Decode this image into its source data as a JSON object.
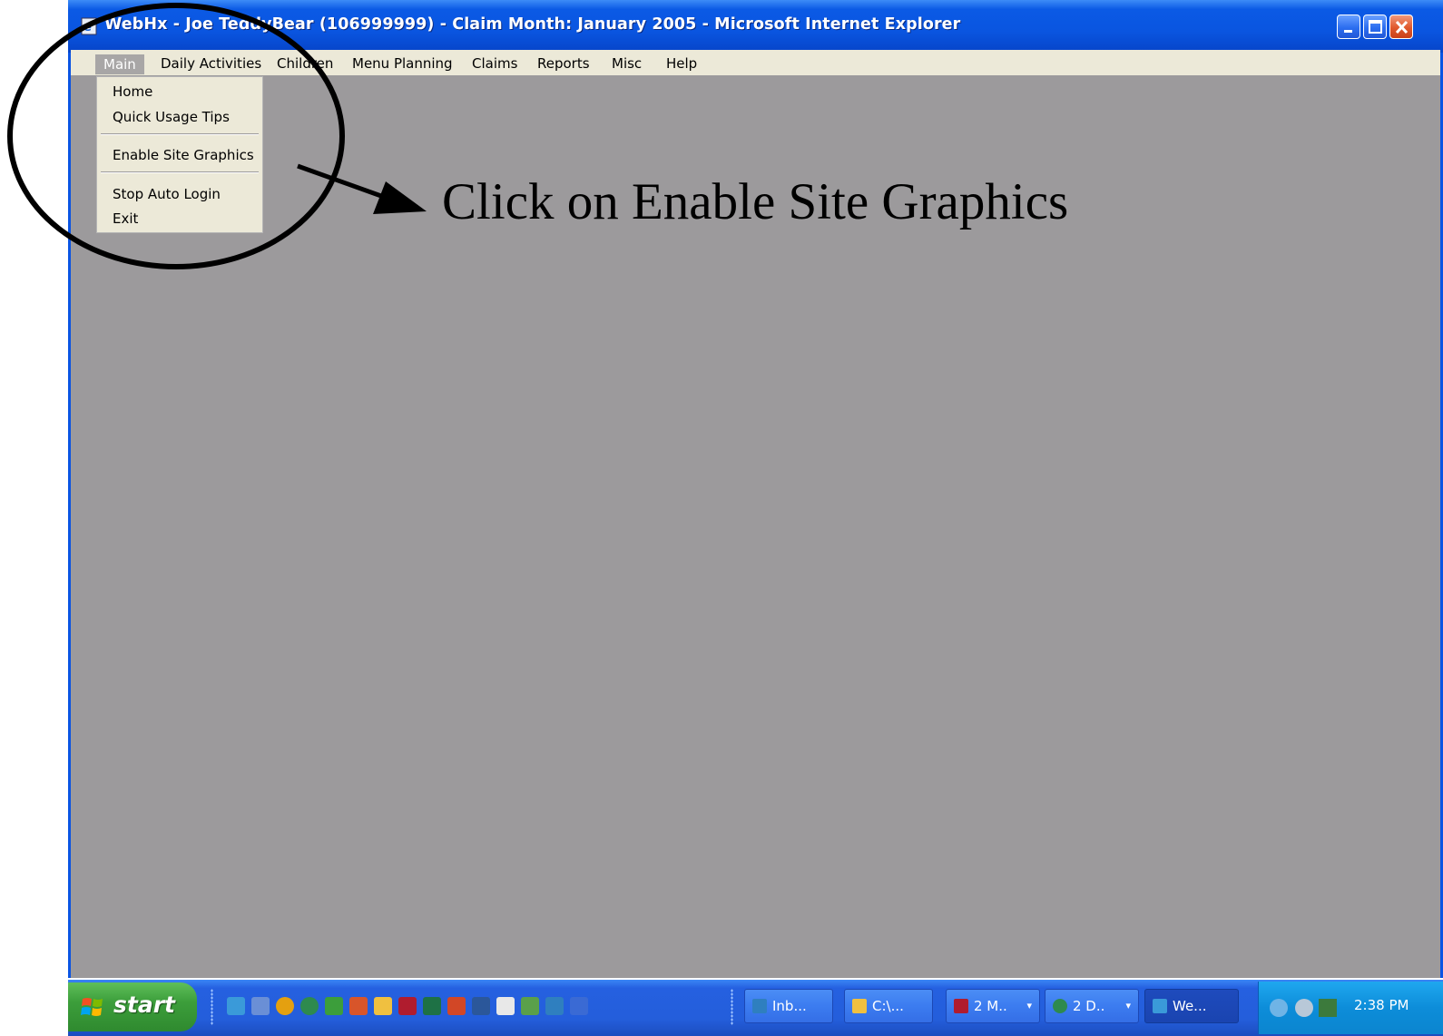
{
  "window": {
    "title": "WebHx - Joe TeddyBear (106999999) - Claim Month: January 2005 - Microsoft Internet Explorer"
  },
  "menubar": {
    "items": [
      "Main",
      "Daily Activities",
      "Children",
      "Menu Planning",
      "Claims",
      "Reports",
      "Misc",
      "Help"
    ],
    "active": "Main"
  },
  "dropdown": {
    "items": [
      "Home",
      "Quick Usage Tips",
      "Enable Site Graphics",
      "Stop Auto Login",
      "Exit"
    ]
  },
  "annotation": {
    "text": "Click on Enable Site Graphics"
  },
  "taskbar": {
    "start_label": "start",
    "quick_launch_icons": [
      "ie-icon",
      "email-icon",
      "media-player-icon",
      "network-icon",
      "app-icon",
      "paint-icon",
      "folder-icon",
      "acrobat-icon",
      "excel-icon",
      "outlook-icon",
      "word-icon",
      "document-icon",
      "gear-icon",
      "outlook-express-icon",
      "visio-icon"
    ],
    "tasks": [
      {
        "label": "Inb...",
        "icon": "outlook-icon",
        "arrow": ""
      },
      {
        "label": "C:\\...",
        "icon": "folder-icon",
        "arrow": ""
      },
      {
        "label": "2 M..",
        "icon": "acrobat-icon",
        "arrow": "▾"
      },
      {
        "label": "2 D..",
        "icon": "network-icon",
        "arrow": "▾"
      },
      {
        "label": "We...",
        "icon": "ie-icon",
        "arrow": ""
      }
    ],
    "tray_icons": [
      "network-error-icon",
      "sound-icon",
      "connection-icon"
    ],
    "clock": "2:38 PM"
  },
  "colors": {
    "title_bar": "#0a55e0",
    "menu_bg": "#ece9d8",
    "client_bg": "#9c9a9c",
    "taskbar": "#245edb",
    "start_button": "#3c9e3b",
    "tray": "#0d8dd9"
  }
}
